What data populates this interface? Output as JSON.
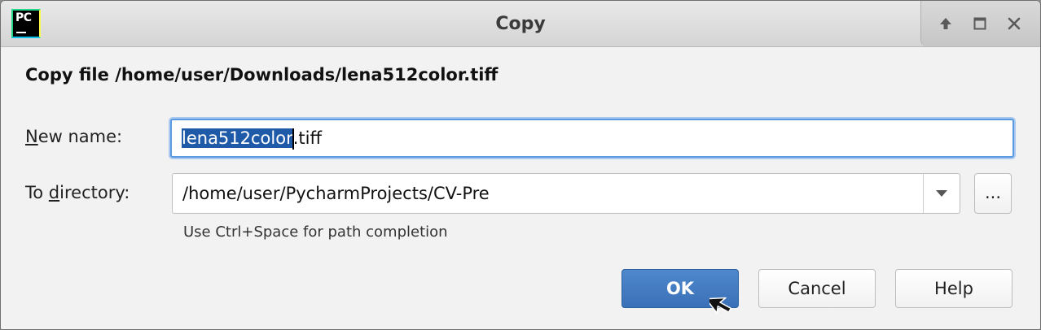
{
  "window": {
    "title": "Copy",
    "app_icon_text": "PC"
  },
  "dialog": {
    "heading": "Copy file /home/user/Downloads/lena512color.tiff",
    "new_name": {
      "label_mnemonic": "N",
      "label_rest": "ew name:",
      "value_selected": "lena512color",
      "value_rest": ".tiff"
    },
    "to_directory": {
      "label_before": "To ",
      "label_mnemonic": "d",
      "label_after": "irectory:",
      "value": "/home/user/PycharmProjects/CV-Pre",
      "browse_label": "...",
      "hint": "Use Ctrl+Space for path completion"
    },
    "buttons": {
      "ok": "OK",
      "cancel": "Cancel",
      "help": "Help"
    }
  },
  "colors": {
    "primary_button": "#3a70b7",
    "focus_border": "#5b9ae0",
    "selection": "#1f5aa8"
  },
  "icons": {
    "app": "pycharm-icon",
    "title_controls": [
      "keep-above-icon",
      "maximize-icon",
      "close-icon"
    ],
    "dropdown": "chevron-down-icon",
    "pointer": "mouse-pointer-icon"
  }
}
